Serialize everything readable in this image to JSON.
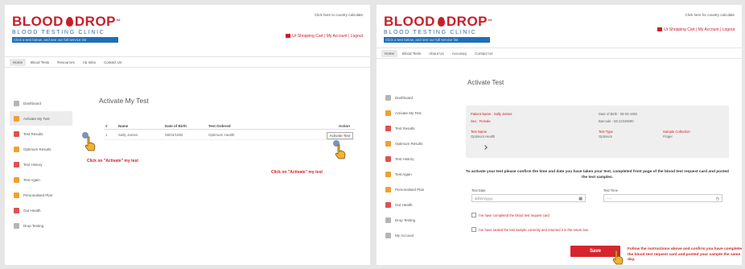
{
  "brand": {
    "name_left": "BLOOD",
    "name_right": "DROP",
    "trademark": "™",
    "subtitle": "BLOOD TESTING CLINIC",
    "bar_text": "Click a test below, and see our full service list"
  },
  "left": {
    "header_small": "Click here to country calculate",
    "header_links": "Ur Shopping Cart | My Account | Logout",
    "nav": [
      "Home",
      "Blood Tests",
      "Resources",
      "Ab Initio",
      "Contact Us"
    ],
    "sidebar": [
      {
        "label": "Dashboard",
        "icon": "dashboard-icon"
      },
      {
        "label": "Activate My Test",
        "icon": "activate-icon"
      },
      {
        "label": "Test Results",
        "icon": "results-icon"
      },
      {
        "label": "Optimum Results",
        "icon": "optimum-icon"
      },
      {
        "label": "Test History",
        "icon": "history-icon"
      },
      {
        "label": "Test Again",
        "icon": "again-icon"
      },
      {
        "label": "Personalised Plan",
        "icon": "plan-icon"
      },
      {
        "label": "Gut Health",
        "icon": "gut-icon"
      },
      {
        "label": "Drop Testing",
        "icon": "drop-icon"
      }
    ],
    "title": "Activate My Test",
    "table": {
      "headers": [
        "#",
        "Name",
        "Date of Birth",
        "Test Ordered",
        "Action"
      ],
      "rows": [
        {
          "num": "1",
          "name": "Sally James",
          "dob": "08/03/1982",
          "test": "Optimum Health",
          "action": "Activate Test"
        }
      ]
    },
    "annotation_left": "Click on \"Activate\" my test",
    "annotation_right": "Click on \"Activate\" my test"
  },
  "right": {
    "header_small": "Click here for country calculate",
    "header_links": "Ur Shopping Cart | My Account | Logout",
    "nav": [
      "Home",
      "Blood Tests",
      "About Us",
      "Accuracy",
      "Contact Us"
    ],
    "sidebar": [
      {
        "label": "Dashboard",
        "icon": "dashboard-icon"
      },
      {
        "label": "Activate My Test",
        "icon": "activate-icon"
      },
      {
        "label": "Test Results",
        "icon": "results-icon"
      },
      {
        "label": "Optimum Results",
        "icon": "optimum-icon"
      },
      {
        "label": "Test History",
        "icon": "history-icon"
      },
      {
        "label": "Test Again",
        "icon": "again-icon"
      },
      {
        "label": "Personalised Plan",
        "icon": "plan-icon"
      },
      {
        "label": "Gut Health",
        "icon": "gut-icon"
      },
      {
        "label": "Drop Testing",
        "icon": "drop-icon"
      },
      {
        "label": "My Account",
        "icon": "account-icon"
      }
    ],
    "title": "Activate Test",
    "info": {
      "patient_name": "Patient Name : Sally James",
      "sex": "Sex : Female",
      "test_name_label": "Test Name",
      "test_name_value": "Optimum Health",
      "dob": "Date of Birth : 08-03-1982",
      "barcode": "Barcode : BC12345690",
      "test_type_label": "Test Type",
      "test_type_value": "Optimum",
      "sample_label": "Sample Collection",
      "sample_value": "Finger"
    },
    "instructions": "To activate your test please confirm the time and date you have taken your test, completed front page of the blood test request card and posted the test samples.",
    "fields": {
      "date_label": "Test Date",
      "date_value": "dd/mm/yyyy",
      "time_label": "Test Time",
      "time_value": "--:--"
    },
    "checks": [
      "I've have completed the blood test request card",
      "I've have sealed the test sample correctly and returned it in the return box"
    ],
    "save_label": "Save",
    "follow_note": "Follow the instructions above and confirm you have completed the blood test request card and posted your sample the same day."
  }
}
